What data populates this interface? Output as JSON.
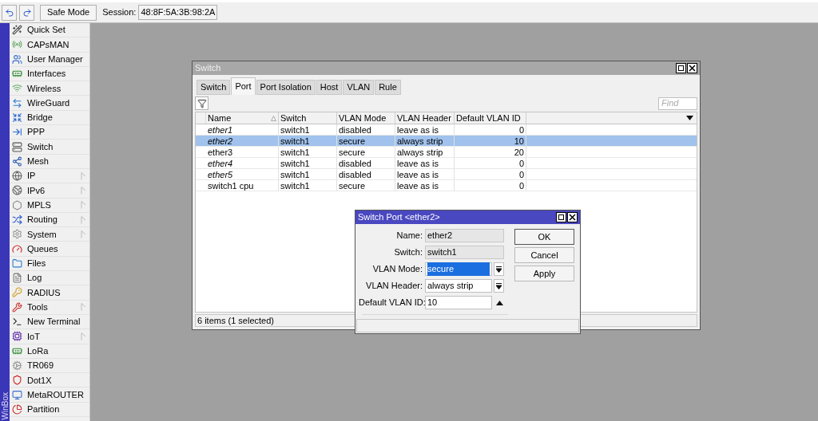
{
  "toolbar": {
    "safe_mode": "Safe Mode",
    "session_label": "Session:",
    "session_value": "48:8F:5A:3B:98:2A"
  },
  "sidebar": {
    "brand": "WinBox",
    "items": [
      {
        "label": "Quick Set",
        "has_submenu": false
      },
      {
        "label": "CAPsMAN",
        "has_submenu": false
      },
      {
        "label": "User Manager",
        "has_submenu": false
      },
      {
        "label": "Interfaces",
        "has_submenu": false
      },
      {
        "label": "Wireless",
        "has_submenu": false
      },
      {
        "label": "WireGuard",
        "has_submenu": false
      },
      {
        "label": "Bridge",
        "has_submenu": false
      },
      {
        "label": "PPP",
        "has_submenu": false
      },
      {
        "label": "Switch",
        "has_submenu": false
      },
      {
        "label": "Mesh",
        "has_submenu": false
      },
      {
        "label": "IP",
        "has_submenu": true
      },
      {
        "label": "IPv6",
        "has_submenu": true
      },
      {
        "label": "MPLS",
        "has_submenu": true
      },
      {
        "label": "Routing",
        "has_submenu": true
      },
      {
        "label": "System",
        "has_submenu": true
      },
      {
        "label": "Queues",
        "has_submenu": false
      },
      {
        "label": "Files",
        "has_submenu": false
      },
      {
        "label": "Log",
        "has_submenu": false
      },
      {
        "label": "RADIUS",
        "has_submenu": false
      },
      {
        "label": "Tools",
        "has_submenu": true
      },
      {
        "label": "New Terminal",
        "has_submenu": false
      },
      {
        "label": "IoT",
        "has_submenu": true
      },
      {
        "label": "LoRa",
        "has_submenu": false
      },
      {
        "label": "TR069",
        "has_submenu": false
      },
      {
        "label": "Dot1X",
        "has_submenu": false
      },
      {
        "label": "MetaROUTER",
        "has_submenu": false
      },
      {
        "label": "Partition",
        "has_submenu": false
      }
    ]
  },
  "switch_window": {
    "title": "Switch",
    "tabs": [
      {
        "label": "Switch",
        "selected": false
      },
      {
        "label": "Port",
        "selected": true
      },
      {
        "label": "Port Isolation",
        "selected": false
      },
      {
        "label": "Host",
        "selected": false
      },
      {
        "label": "VLAN",
        "selected": false
      },
      {
        "label": "Rule",
        "selected": false
      }
    ],
    "find_placeholder": "Find",
    "table": {
      "columns": [
        "Name",
        "Switch",
        "VLAN Mode",
        "VLAN Header",
        "Default VLAN ID"
      ],
      "rows": [
        {
          "cells": [
            "ether1",
            "switch1",
            "disabled",
            "leave as is",
            "0"
          ],
          "italic": true,
          "selected": false
        },
        {
          "cells": [
            "ether2",
            "switch1",
            "secure",
            "always strip",
            "10"
          ],
          "italic": true,
          "selected": true
        },
        {
          "cells": [
            "ether3",
            "switch1",
            "secure",
            "always strip",
            "20"
          ],
          "italic": false,
          "selected": false
        },
        {
          "cells": [
            "ether4",
            "switch1",
            "disabled",
            "leave as is",
            "0"
          ],
          "italic": true,
          "selected": false
        },
        {
          "cells": [
            "ether5",
            "switch1",
            "disabled",
            "leave as is",
            "0"
          ],
          "italic": true,
          "selected": false
        },
        {
          "cells": [
            "switch1 cpu",
            "switch1",
            "secure",
            "leave as is",
            "0"
          ],
          "italic": false,
          "selected": false
        }
      ]
    },
    "status": "6 items (1 selected)"
  },
  "port_dialog": {
    "title": "Switch Port <ether2>",
    "fields": [
      {
        "label": "Name:",
        "value": "ether2",
        "kind": "readonly",
        "selected": false
      },
      {
        "label": "Switch:",
        "value": "switch1",
        "kind": "readonly",
        "selected": false
      },
      {
        "label": "VLAN Mode:",
        "value": "secure",
        "kind": "dropdown",
        "selected": true
      },
      {
        "label": "VLAN Header:",
        "value": "always strip",
        "kind": "dropdown",
        "selected": false
      },
      {
        "label": "Default VLAN ID:",
        "value": "10",
        "kind": "spin",
        "selected": false
      }
    ],
    "buttons": [
      "OK",
      "Cancel",
      "Apply"
    ]
  }
}
